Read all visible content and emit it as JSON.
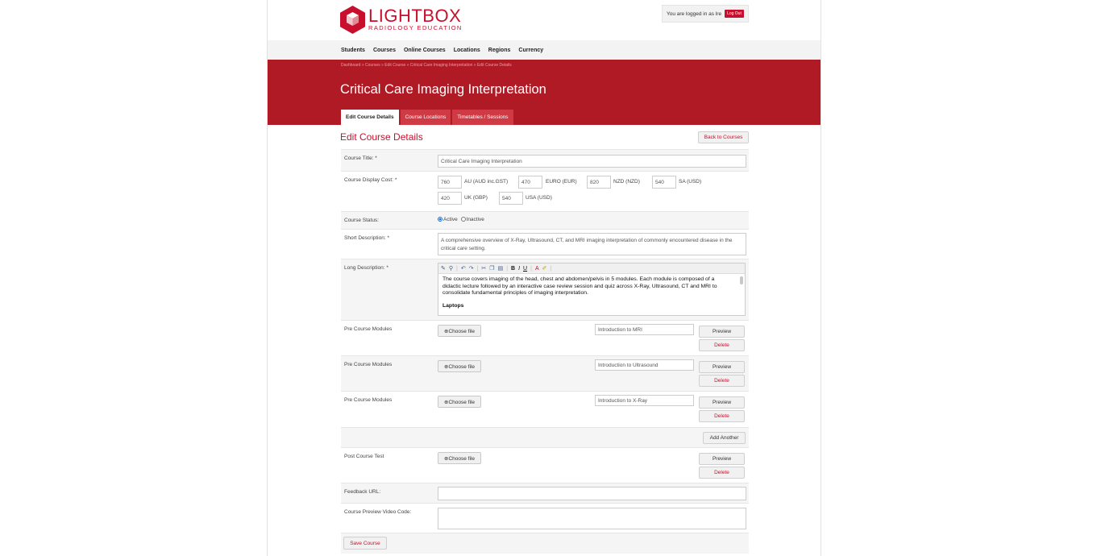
{
  "header": {
    "brand": "LIGHTBOX",
    "subtitle": "RADIOLOGY EDUCATION",
    "logged_in_text": "You are logged in as lre",
    "logout_label": "Log Out"
  },
  "nav": [
    "Students",
    "Courses",
    "Online Courses",
    "Locations",
    "Regions",
    "Currency"
  ],
  "breadcrumb": "Dashboard  »  Courses  »  Edit Course  »  Critical Care Imaging Interpretation  »  Edit Course Details",
  "page_title": "Critical Care Imaging Interpretation",
  "tabs": [
    "Edit Course Details",
    "Course Locations",
    "Timetables / Sessions"
  ],
  "section_title": "Edit Course Details",
  "back_button": "Back to Courses",
  "form": {
    "course_title_label": "Course Title: *",
    "course_title_value": "Critical Care Imaging Interpretation",
    "display_cost_label": "Course Display Cost: *",
    "costs": [
      {
        "value": "760",
        "currency": "AU (AUD inc.GST)"
      },
      {
        "value": "470",
        "currency": "EURO (EUR)"
      },
      {
        "value": "820",
        "currency": "NZD (NZD)"
      },
      {
        "value": "540",
        "currency": "SA (USD)"
      },
      {
        "value": "420",
        "currency": "UK (GBP)"
      },
      {
        "value": "540",
        "currency": "USA (USD)"
      }
    ],
    "status_label": "Course Status:",
    "status_active": "Active",
    "status_inactive": "Inactive",
    "short_desc_label": "Short Description: *",
    "short_desc_value": "A comprehensive overview of X-Ray, Ultrasound, CT, and MRI imaging interpretation of commonly encountered disease in the critical care setting.",
    "long_desc_label": "Long Description: *",
    "long_desc_paragraph": "The course covers imaging of the head, chest and abdomen/pelvis in 5 modules. Each module is composed of a didactic lecture followed by an interactive case review session and quiz across X-Ray, Ultrasound, CT and MRI to consolidate fundamental principles of imaging interpretation.",
    "long_desc_heading": "Laptops",
    "modules_label": "Pre Course Modules",
    "choose_file": "⊕Choose file",
    "modules": [
      "Introduction to MRI",
      "Introduction to Ultrasound",
      "Introduction to X-Ray"
    ],
    "preview_label": "Preview",
    "delete_label": "Delete",
    "add_another": "Add Another",
    "post_test_label": "Post Course Test",
    "feedback_label": "Feedback URL:",
    "feedback_value": "",
    "video_label": "Course Preview Video Code:",
    "video_value": "",
    "save_button": "Save Course"
  },
  "colors": {
    "brand_red": "#c8102e",
    "band_red": "#b01a25"
  }
}
